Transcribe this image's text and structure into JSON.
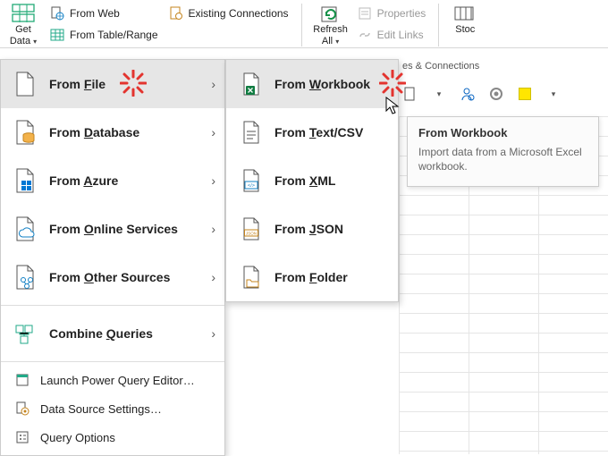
{
  "ribbon": {
    "get_data": {
      "line1": "Get",
      "line2": "Data"
    },
    "from_web": "From Web",
    "from_table": "From Table/Range",
    "existing_conn": "Existing Connections",
    "refresh": {
      "line1": "Refresh",
      "line2": "All"
    },
    "properties": "Properties",
    "edit_links": "Edit Links",
    "stocks": "Stoc"
  },
  "qc_label": "es & Connections",
  "menu1": {
    "items": [
      {
        "pre": "From ",
        "u": "F",
        "post": "ile"
      },
      {
        "pre": "From ",
        "u": "D",
        "post": "atabase"
      },
      {
        "pre": "From ",
        "u": "A",
        "post": "zure"
      },
      {
        "pre": "From ",
        "u": "O",
        "post": "nline Services"
      },
      {
        "pre": "From ",
        "u": "O",
        "post": "ther Sources"
      },
      {
        "pre": "Combine ",
        "u": "Q",
        "post": "ueries"
      }
    ],
    "flat": {
      "launch_pq": "Launch Power Query Editor…",
      "data_src": "Data Source Settings…",
      "query_opt": "Query Options"
    }
  },
  "menu2": {
    "items": [
      {
        "pre": "From ",
        "u": "W",
        "post": "orkbook"
      },
      {
        "pre": "From ",
        "u": "T",
        "post": "ext/CSV"
      },
      {
        "pre": "From ",
        "u": "X",
        "post": "ML"
      },
      {
        "pre": "From ",
        "u": "J",
        "post": "SON"
      },
      {
        "pre": "From ",
        "u": "F",
        "post": "older"
      }
    ]
  },
  "tooltip": {
    "title": "From Workbook",
    "body": "Import data from a Microsoft Excel workbook."
  }
}
